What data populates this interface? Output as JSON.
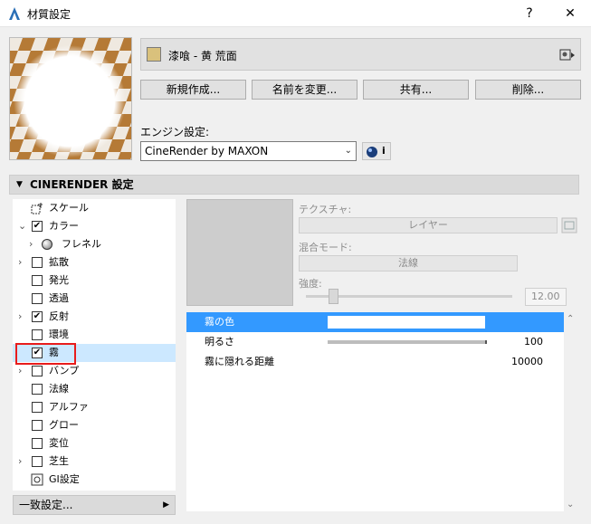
{
  "window": {
    "title": "材質設定",
    "help": "?",
    "close": "✕"
  },
  "material": {
    "name": "漆喰 - 黄 荒面",
    "swatch_color": "#d9c17c"
  },
  "buttons": {
    "new": "新規作成...",
    "rename": "名前を変更...",
    "share": "共有...",
    "delete": "削除..."
  },
  "engine": {
    "label": "エンジン設定:",
    "value": "CineRender by MAXON",
    "info": "i"
  },
  "section": {
    "title": "CINERENDER 設定"
  },
  "tree": [
    {
      "label": "スケール",
      "check": "",
      "chev": "",
      "icon": "scale"
    },
    {
      "label": "カラー",
      "check": "✔",
      "chev": "⌄",
      "icon": ""
    },
    {
      "label": "フレネル",
      "check": "",
      "chev": "›",
      "icon": "sphere"
    },
    {
      "label": "拡散",
      "check": "",
      "chev": "›",
      "icon": ""
    },
    {
      "label": "発光",
      "check": "",
      "chev": "",
      "icon": ""
    },
    {
      "label": "透過",
      "check": "",
      "chev": "",
      "icon": ""
    },
    {
      "label": "反射",
      "check": "✔",
      "chev": "›",
      "icon": ""
    },
    {
      "label": "環境",
      "check": "",
      "chev": "",
      "icon": ""
    },
    {
      "label": "霧",
      "check": "✔",
      "chev": "",
      "icon": ""
    },
    {
      "label": "バンプ",
      "check": "",
      "chev": "›",
      "icon": ""
    },
    {
      "label": "法線",
      "check": "",
      "chev": "",
      "icon": ""
    },
    {
      "label": "アルファ",
      "check": "",
      "chev": "",
      "icon": ""
    },
    {
      "label": "グロー",
      "check": "",
      "chev": "",
      "icon": ""
    },
    {
      "label": "変位",
      "check": "",
      "chev": "",
      "icon": ""
    },
    {
      "label": "芝生",
      "check": "",
      "chev": "›",
      "icon": ""
    },
    {
      "label": "GI設定",
      "check": "",
      "chev": "",
      "icon": "gi"
    }
  ],
  "texture": {
    "label": "テクスチャ:",
    "layer": "レイヤー",
    "blend_label": "混合モード:",
    "blend": "法線",
    "strength_label": "強度:",
    "strength": "12.00"
  },
  "properties": [
    {
      "name": "霧の色",
      "value": ""
    },
    {
      "name": "明るさ",
      "value": "100"
    },
    {
      "name": "霧に隠れる距離",
      "value": "10000"
    }
  ],
  "footer": {
    "match": "一致設定..."
  }
}
